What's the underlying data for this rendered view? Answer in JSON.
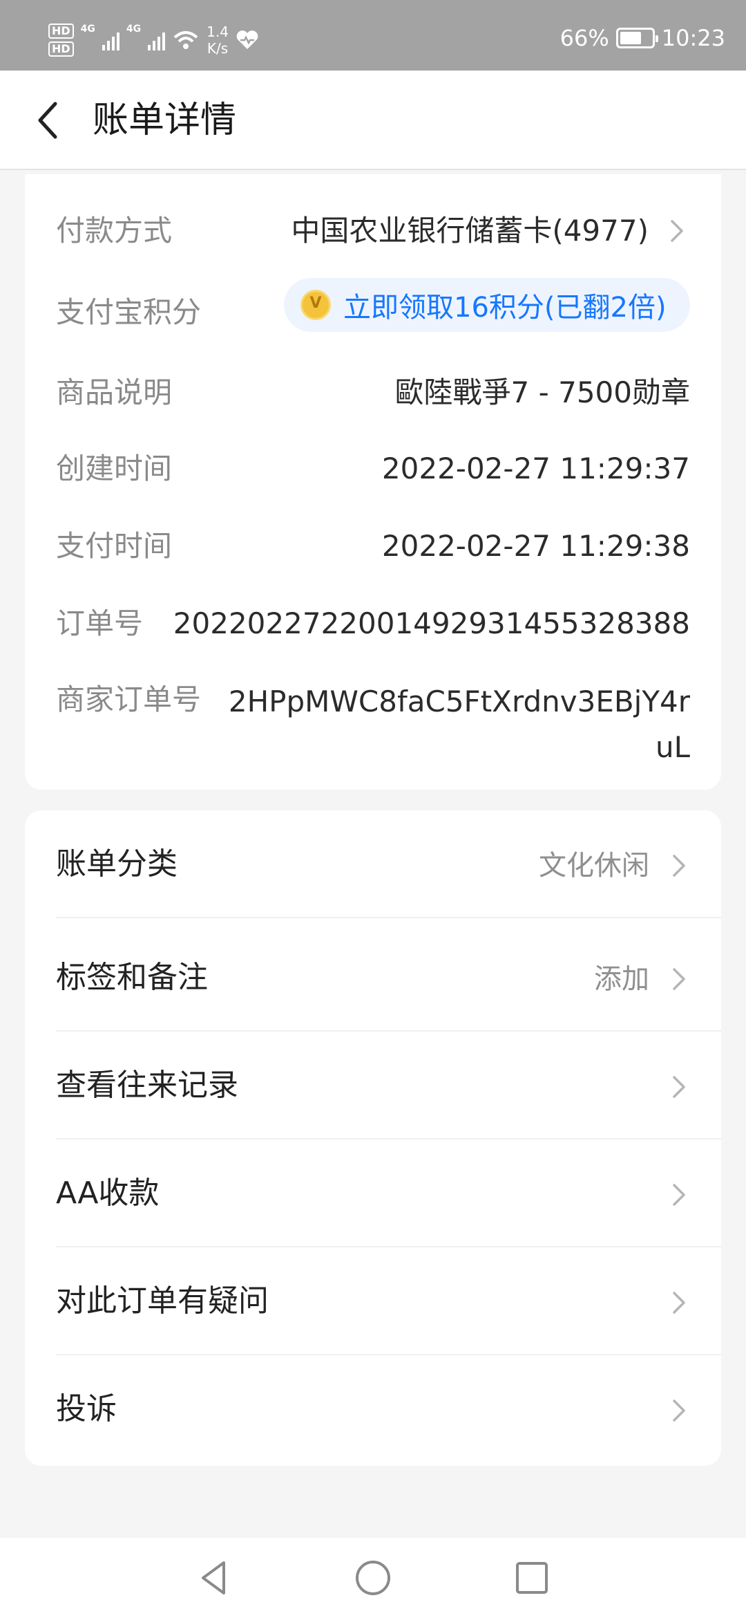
{
  "status_bar": {
    "sim1": "HD",
    "sim2": "HD",
    "net1": "4G",
    "net2": "4G",
    "speed_value": "1.4",
    "speed_unit": "K/s",
    "battery": "66%",
    "time": "10:23"
  },
  "header": {
    "title": "账单详情"
  },
  "details": {
    "payment_method": {
      "label": "付款方式",
      "value": "中国农业银行储蓄卡(4977)"
    },
    "points": {
      "label": "支付宝积分",
      "value": "立即领取16积分(已翻2倍)"
    },
    "product": {
      "label": "商品说明",
      "value": "歐陸戰爭7 - 7500勋章"
    },
    "created": {
      "label": "创建时间",
      "value": "2022-02-27 11:29:37"
    },
    "paid": {
      "label": "支付时间",
      "value": "2022-02-27 11:29:38"
    },
    "order_no": {
      "label": "订单号",
      "value": "2022022722001492931455328388"
    },
    "merchant_order_no": {
      "label": "商家订单号",
      "value": "2HPpMWC8faC5FtXrdnv3EBjY4ruL"
    }
  },
  "actions": [
    {
      "label": "账单分类",
      "value": "文化休闲"
    },
    {
      "label": "标签和备注",
      "value": "添加"
    },
    {
      "label": "查看往来记录",
      "value": ""
    },
    {
      "label": "AA收款",
      "value": ""
    },
    {
      "label": "对此订单有疑问",
      "value": ""
    },
    {
      "label": "投诉",
      "value": ""
    }
  ],
  "colors": {
    "status_bar_bg": "#a3a3a3",
    "accent_blue": "#1677ff",
    "points_pill_bg": "#eef4fe",
    "page_bg": "#f5f5f5"
  },
  "icons": [
    "back-arrow-icon",
    "chevron-right-icon",
    "points-coin-icon",
    "wifi-icon",
    "heart-icon",
    "battery-icon",
    "nav-back-icon",
    "nav-home-icon",
    "nav-recents-icon"
  ]
}
